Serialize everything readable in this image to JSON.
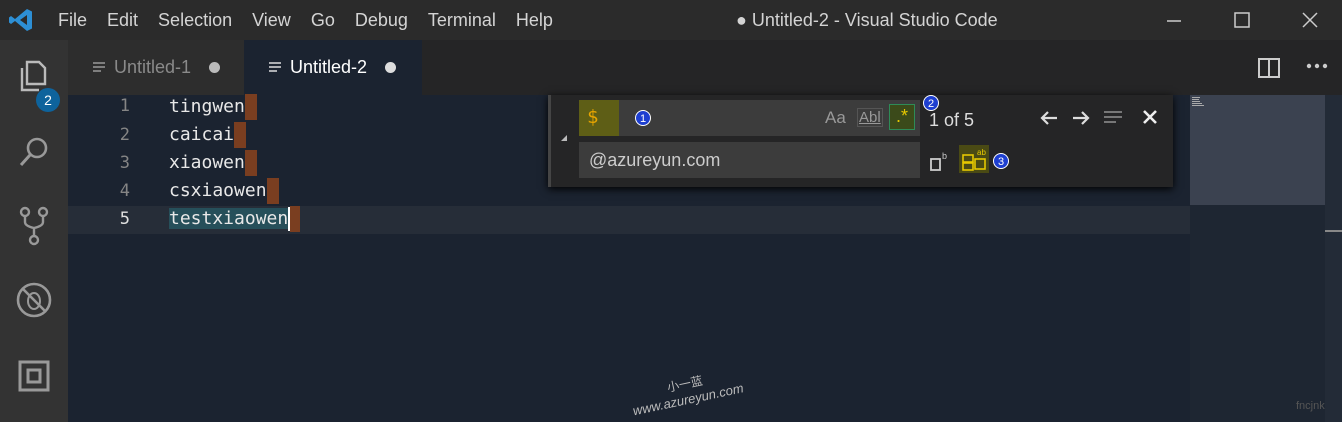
{
  "window": {
    "title": "● Untitled-2 - Visual Studio Code"
  },
  "menu": [
    "File",
    "Edit",
    "Selection",
    "View",
    "Go",
    "Debug",
    "Terminal",
    "Help"
  ],
  "activity": {
    "explorer_badge": "2"
  },
  "tabs": [
    {
      "label": "Untitled-1",
      "active": false,
      "dirty": true
    },
    {
      "label": "Untitled-2",
      "active": true,
      "dirty": true
    }
  ],
  "editor": {
    "lines": [
      {
        "num": "1",
        "text": "tingwen"
      },
      {
        "num": "2",
        "text": "caicai"
      },
      {
        "num": "3",
        "text": "xiaowen"
      },
      {
        "num": "4",
        "text": "csxiaowen"
      },
      {
        "num": "5",
        "text": "testxiaowen"
      }
    ],
    "current_line": 5
  },
  "find": {
    "find_value": "$",
    "replace_value": "@azureyun.com",
    "match_count": "1 of 5",
    "match_case_label": "Aa",
    "whole_word_label": "Abl",
    "regex_label": ".*",
    "callouts": [
      "1",
      "2",
      "3"
    ]
  },
  "watermark": {
    "brand_cn": "小一蓝",
    "brand_url": "www.azureyun.com",
    "corner": "fncjnk"
  },
  "colors": {
    "accent": "#0e639c",
    "editor_bg": "#1b2330",
    "match_marker": "#7a3e20",
    "regex_active": "#2f6f3a"
  }
}
